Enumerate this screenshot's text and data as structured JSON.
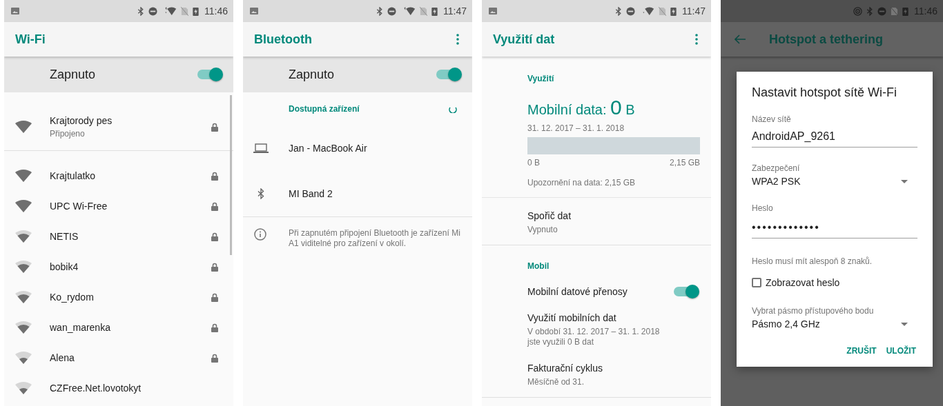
{
  "wifi_screen": {
    "status_bar": {
      "time": "11:46"
    },
    "title": "Wi-Fi",
    "master_switch": {
      "label": "Zapnuto",
      "on": true
    },
    "networks": [
      {
        "name": "Krajtorody pes",
        "status": "Připojeno",
        "kind": "strong"
      },
      {
        "name": "Krajtulatko",
        "kind": "strong"
      },
      {
        "name": "UPC Wi-Free",
        "kind": "strong"
      },
      {
        "name": "NETIS",
        "kind": "medium"
      },
      {
        "name": "bobik4",
        "kind": "medium"
      },
      {
        "name": "Ko_rydom",
        "kind": "medium"
      },
      {
        "name": "wan_marenka",
        "kind": "medium"
      },
      {
        "name": "Alena",
        "kind": "weak"
      },
      {
        "name": "CZFree.Net.lovotokyt",
        "kind": "weak",
        "secured": false
      }
    ]
  },
  "bluetooth_screen": {
    "status_bar": {
      "time": "11:47"
    },
    "title": "Bluetooth",
    "master_switch": {
      "label": "Zapnuto",
      "on": true
    },
    "section_title": "Dostupná zařízení",
    "devices": [
      {
        "name": "Jan - MacBook Air",
        "kind": "laptop"
      },
      {
        "name": "MI Band 2",
        "kind": "bluetooth"
      }
    ],
    "info": "Při zapnutém připojení Bluetooth je zařízení Mi A1 viditelné pro zařízení v okolí."
  },
  "data_usage_screen": {
    "status_bar": {
      "time": "11:47"
    },
    "title": "Využití dat",
    "usage": {
      "section_title": "Využití",
      "label": "Mobilní data:",
      "value": "0",
      "unit": "B",
      "period": "31. 12. 2017 – 31. 1. 2018",
      "level": 0,
      "min_label": "0 B",
      "max_label": "2,15 GB",
      "warning": "Upozornění na data: 2,15 GB"
    },
    "data_saver": {
      "title": "Spořič dat",
      "summary": "Vypnuto"
    },
    "mobile": {
      "section_title": "Mobil",
      "switch": {
        "label": "Mobilní datové přenosy",
        "on": true
      },
      "items": [
        {
          "title": "Využití mobilních dat",
          "summary": "V období 31. 12. 2017 – 31. 1. 2018\njste využili 0 B dat"
        },
        {
          "title": "Fakturační cyklus",
          "summary": "Měsíčně od 31."
        }
      ]
    }
  },
  "hotspot_screen": {
    "status_bar": {
      "time": "11:46"
    },
    "title": "Hotspot a tethering",
    "dialog": {
      "title": "Nastavit hotspot sítě Wi-Fi",
      "network_name": {
        "label": "Název sítě",
        "value": "AndroidAP_9261"
      },
      "security": {
        "label": "Zabezpečení",
        "value": "WPA2 PSK"
      },
      "password": {
        "label": "Heslo",
        "value": "•••••••••••••",
        "helper": "Heslo musí mít alespoň 8 znaků."
      },
      "show_password": {
        "label": "Zobrazovat heslo",
        "checked": false
      },
      "band": {
        "label": "Vybrat pásmo přístupového bodu",
        "value": "Pásmo 2,4 GHz"
      },
      "buttons": [
        "ZRUŠIT",
        "ULOŽIT"
      ]
    }
  }
}
